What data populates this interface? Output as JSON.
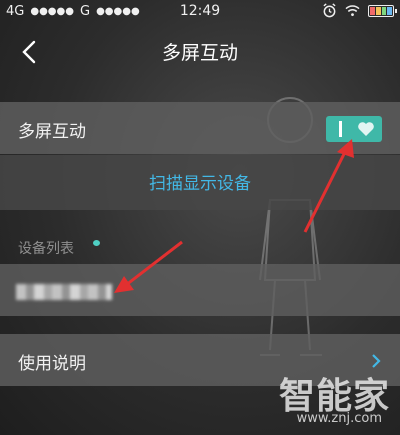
{
  "status_bar": {
    "carrier1": "4G",
    "carrier2": "G",
    "signal_dots": "●●●●●",
    "time": "12:49",
    "icons": [
      "alarm-icon",
      "wifi-icon",
      "battery-icon"
    ]
  },
  "nav": {
    "title": "多屏互动",
    "back_icon": "chevron-left-icon"
  },
  "multiscreen": {
    "label": "多屏互动",
    "toggle_on": true,
    "toggle_color": "#3fb8a8"
  },
  "scan": {
    "label": "扫描显示设备",
    "color": "#43b8e6"
  },
  "device_list": {
    "label": "设备列表"
  },
  "instructions": {
    "label": "使用说明",
    "chevron_color": "#43b8e6"
  },
  "watermark": {
    "logo": "智能家",
    "url": "www.znj.com"
  },
  "annotation_color": "#e23030"
}
